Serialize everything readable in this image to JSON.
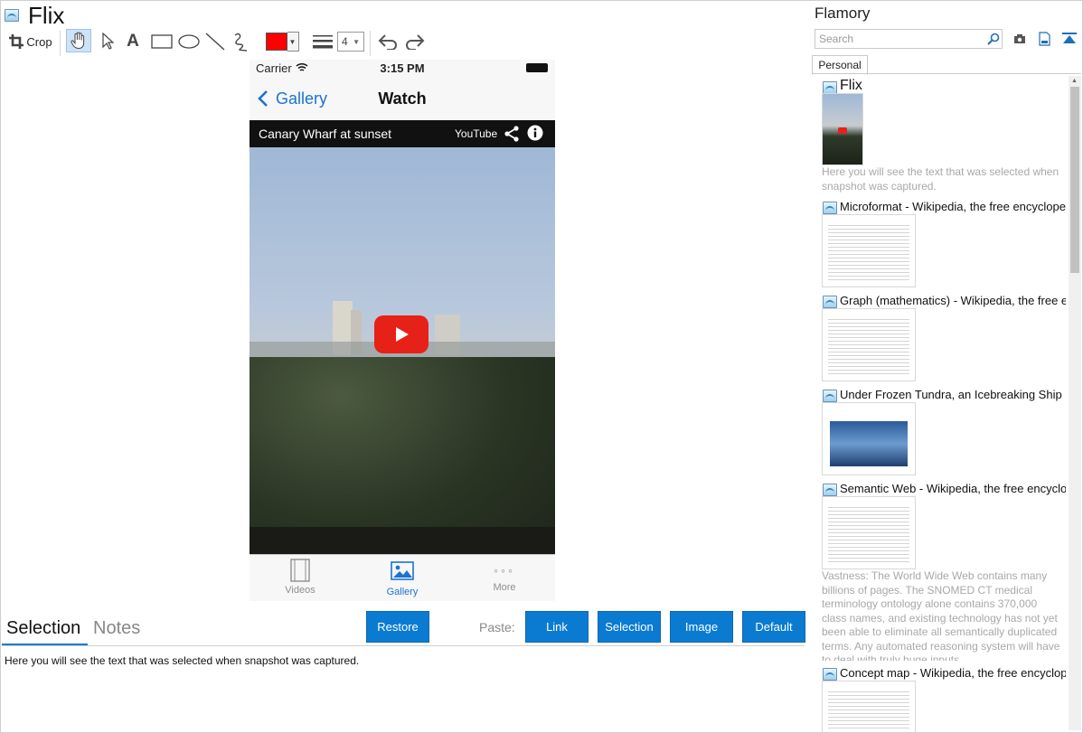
{
  "window": {
    "title": "Flix"
  },
  "toolbar": {
    "crop_label": "Crop",
    "color": "#ff0000",
    "line_width": "4"
  },
  "phone": {
    "carrier": "Carrier",
    "time": "3:15 PM",
    "back_label": "Gallery",
    "nav_title": "Watch",
    "video_title": "Canary Wharf at sunset",
    "youtube_label": "YouTube",
    "tabs": [
      {
        "label": "Videos"
      },
      {
        "label": "Gallery"
      },
      {
        "label": "More"
      }
    ]
  },
  "bottom": {
    "tab_selection": "Selection",
    "tab_notes": "Notes",
    "restore_label": "Restore",
    "paste_label": "Paste:",
    "paste_buttons": [
      "Link",
      "Selection",
      "Image",
      "Default"
    ],
    "selection_text": "Here you will see the text that was selected when snapshot was captured."
  },
  "sidebar": {
    "title": "Flamory",
    "search_placeholder": "Search",
    "tab_personal": "Personal",
    "entries": [
      {
        "title": "Flix",
        "note": "Here you will see the text that was selected when snapshot was captured."
      },
      {
        "title": "Microformat - Wikipedia, the free encyclopedia"
      },
      {
        "title": "Graph (mathematics) - Wikipedia, the free ency"
      },
      {
        "title": "Under Frozen Tundra, an Icebreaking Ship Unco"
      },
      {
        "title": "Semantic Web - Wikipedia, the free encycloped",
        "note": "Vastness: The World Wide Web contains many billions of pages. The SNOMED CT medical terminology ontology alone contains 370,000 class names, and existing technology has not yet been able to eliminate all semantically duplicated terms. Any automated reasoning system will have to deal with truly huge inputs."
      },
      {
        "title": "Concept map - Wikipedia, the free encyclopedi"
      }
    ]
  },
  "colors": {
    "accent": "#0a7bd1",
    "ios_blue": "#1a73d1",
    "pen_color": "#ff0000"
  }
}
